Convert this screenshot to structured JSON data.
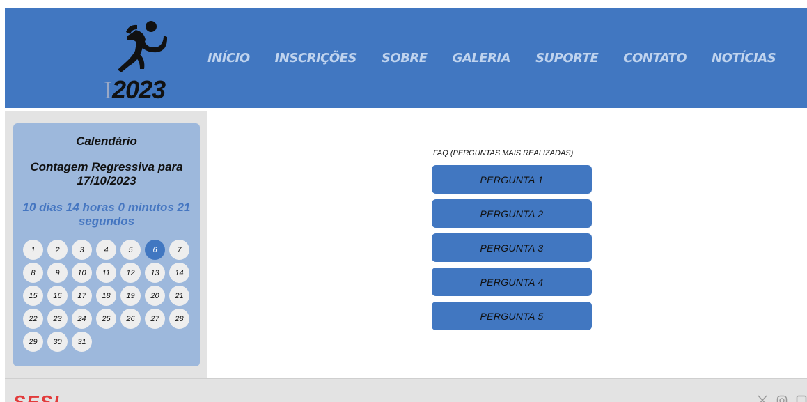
{
  "header": {
    "logo_bar": "I",
    "logo_year": "2023",
    "nav": [
      "INÍCIO",
      "INSCRIÇÕES",
      "SOBRE",
      "GALERIA",
      "SUPORTE",
      "CONTATO",
      "NOTÍCIAS"
    ]
  },
  "calendar": {
    "title": "Calendário",
    "countdown_label": "Contagem Regressiva para 17/10/2023",
    "countdown_value": "10 dias 14 horas 0 minutos 21 segundos",
    "days": [
      "1",
      "2",
      "3",
      "4",
      "5",
      "6",
      "7",
      "8",
      "9",
      "10",
      "11",
      "12",
      "13",
      "14",
      "15",
      "16",
      "17",
      "18",
      "19",
      "20",
      "21",
      "22",
      "23",
      "24",
      "25",
      "26",
      "27",
      "28",
      "29",
      "30",
      "31"
    ],
    "today": "6"
  },
  "faq": {
    "title": "FAQ (PERGUNTAS MAIS REALIZADAS)",
    "questions": [
      "PERGUNTA 1",
      "PERGUNTA 2",
      "PERGUNTA 3",
      "PERGUNTA 4",
      "PERGUNTA 5"
    ]
  },
  "footer": {
    "logo_text": "SESI",
    "social_icons": [
      "x-icon",
      "instagram-icon",
      "facebook-icon"
    ]
  },
  "colors": {
    "primary": "#4177c1",
    "card": "#9db8dc",
    "panel": "#e3e3e3",
    "brand_red": "#e23b3b"
  }
}
